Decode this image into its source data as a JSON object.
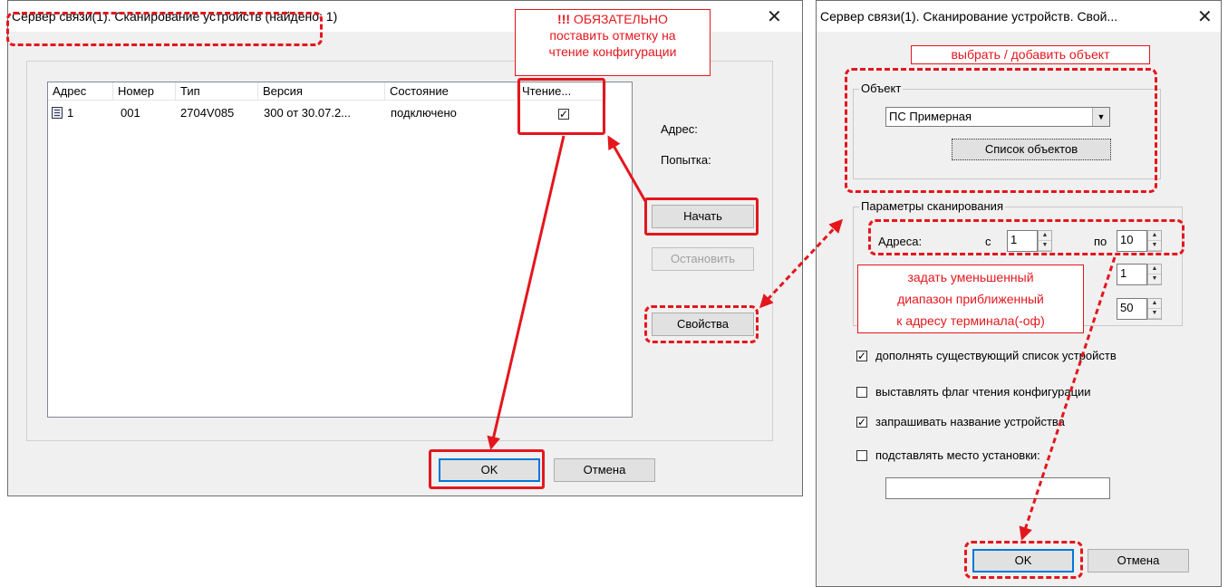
{
  "left_dialog": {
    "title": "Сервер связи(1). Сканирование устройств (найдено: 1)",
    "columns": [
      "Адрес",
      "Номер",
      "Тип",
      "Версия",
      "Состояние",
      "Чтение..."
    ],
    "rows": [
      {
        "address": "1",
        "number": "001",
        "type": "2704V085",
        "version": "300 от 30.07.2...",
        "state": "подключено",
        "read": "✓"
      }
    ],
    "address_label": "Адрес:",
    "attempt_label": "Попытка:",
    "start_button": "Начать",
    "stop_button": "Остановить",
    "properties_button": "Свойства",
    "ok_button": "OK",
    "cancel_button": "Отмена",
    "close_glyph": "✕"
  },
  "right_dialog": {
    "title": "Сервер связи(1). Сканирование устройств. Свой...",
    "object_group": "Объект",
    "object_value": "ПС Примерная",
    "object_list_button": "Список объектов",
    "scan_group": "Параметры сканирования",
    "addresses_label": "Адреса:",
    "from_label": "с",
    "from_value": "1",
    "to_label": "по",
    "to_value": "10",
    "attempts_value": "1",
    "timeout_value": "50",
    "checkboxes": [
      {
        "label": "дополнять существующий список устройств",
        "checked": true
      },
      {
        "label": "выставлять флаг чтения конфигурации",
        "checked": false
      },
      {
        "label": "запрашивать название устройства",
        "checked": true
      },
      {
        "label": "подставлять место установки:",
        "checked": false
      }
    ],
    "location_value": "",
    "ok_button": "OK",
    "cancel_button": "Отмена",
    "close_glyph": "✕"
  },
  "annotations": {
    "note_read_bold": "!!!",
    "note_read_line1": " ОБЯЗАТЕЛЬНО",
    "note_read_line2": "поставить отметку на",
    "note_read_line3": "чтение конфигурации",
    "note_object": "выбрать / добавить объект",
    "note_range_line1": "задать уменьшенный",
    "note_range_line2": "диапазон приближенный",
    "note_range_line3": "к адресу терминала(-оф)",
    "accent_color": "#e4161d"
  }
}
